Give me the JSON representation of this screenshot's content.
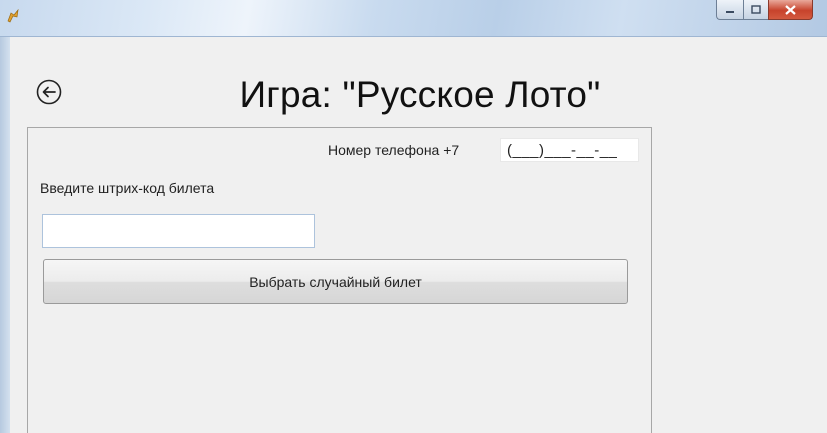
{
  "window": {
    "title": "",
    "controls": [
      "minimize-icon",
      "maximize-icon",
      "close-icon"
    ]
  },
  "header": {
    "back_icon": "arrow-left-circle-icon",
    "title": "Игра: \"Русское Лото\""
  },
  "form": {
    "phone_label": "Номер телефона +7",
    "phone_value": "(___)___-__-__",
    "barcode_label": "Введите штрих-код билета",
    "barcode_value": "",
    "random_ticket_button": "Выбрать случайный билет"
  }
}
